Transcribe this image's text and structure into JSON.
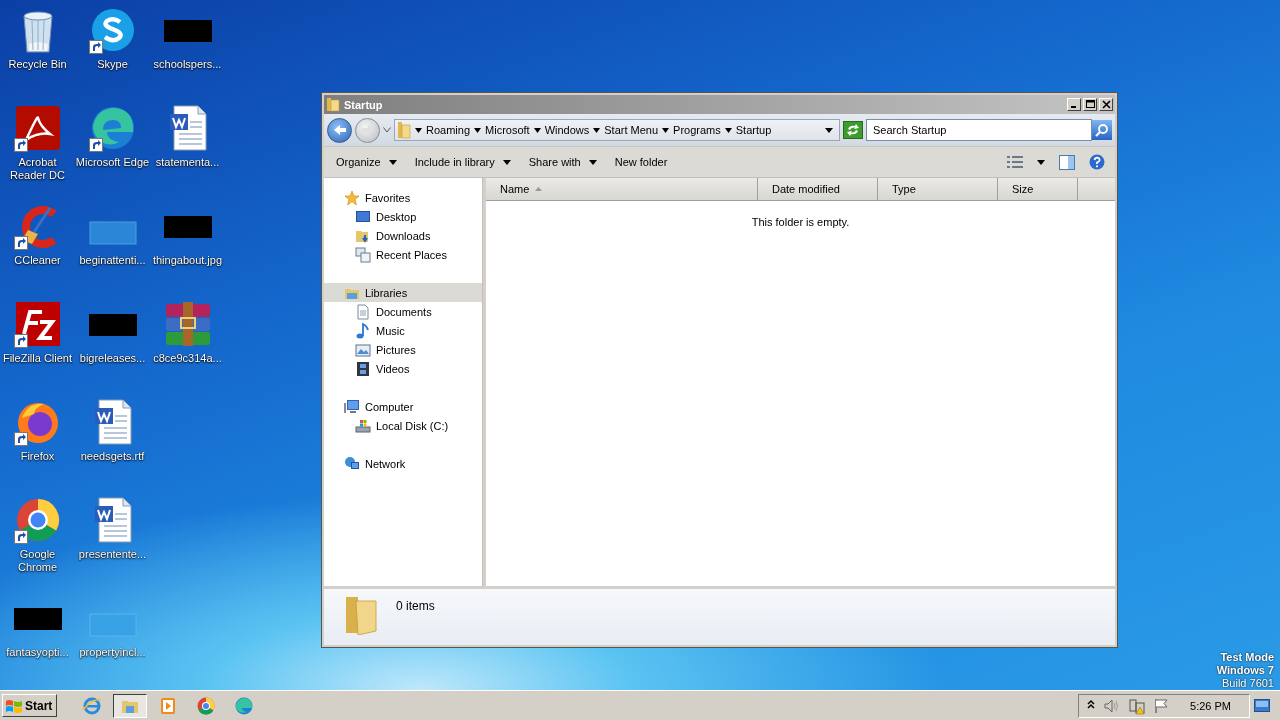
{
  "desktop": {
    "icons": [
      {
        "label": "Recycle Bin",
        "shortcut": false
      },
      {
        "label": "Acrobat Reader DC",
        "shortcut": true
      },
      {
        "label": "CCleaner",
        "shortcut": true
      },
      {
        "label": "FileZilla Client",
        "shortcut": true
      },
      {
        "label": "Firefox",
        "shortcut": true
      },
      {
        "label": "Google Chrome",
        "shortcut": true
      },
      {
        "label": "fantasyopti...",
        "shortcut": false
      },
      {
        "label": "Skype",
        "shortcut": true
      },
      {
        "label": "Microsoft Edge",
        "shortcut": true
      },
      {
        "label": "beginattenti...",
        "shortcut": false
      },
      {
        "label": "bigreleases...",
        "shortcut": false
      },
      {
        "label": "needsgets.rtf",
        "shortcut": false
      },
      {
        "label": "presentente...",
        "shortcut": false
      },
      {
        "label": "propertyincl...",
        "shortcut": false
      },
      {
        "label": "schoolspers...",
        "shortcut": false
      },
      {
        "label": "statementa...",
        "shortcut": false
      },
      {
        "label": "thingabout.jpg",
        "shortcut": false
      },
      {
        "label": "c8ce9c314a...",
        "shortcut": false
      }
    ],
    "os_notice": [
      "Test Mode",
      "Windows 7",
      "Build 7601"
    ]
  },
  "window": {
    "title": "Startup",
    "breadcrumbs": [
      "Roaming",
      "Microsoft",
      "Windows",
      "Start Menu",
      "Programs",
      "Startup"
    ],
    "search": {
      "placeholder": "Search Startup"
    },
    "toolbar": [
      {
        "label": "Organize",
        "dropdown": true
      },
      {
        "label": "Include in library",
        "dropdown": true
      },
      {
        "label": "Share with",
        "dropdown": true
      },
      {
        "label": "New folder",
        "dropdown": false
      }
    ],
    "nav": [
      {
        "label": "Favorites",
        "selected": false,
        "children": [
          {
            "label": "Desktop",
            "selected": false
          },
          {
            "label": "Downloads",
            "selected": false
          },
          {
            "label": "Recent Places",
            "selected": false
          }
        ]
      },
      {
        "label": "Libraries",
        "selected": true,
        "children": [
          {
            "label": "Documents",
            "selected": false
          },
          {
            "label": "Music",
            "selected": false
          },
          {
            "label": "Pictures",
            "selected": false
          },
          {
            "label": "Videos",
            "selected": false
          }
        ]
      },
      {
        "label": "Computer",
        "selected": false,
        "children": [
          {
            "label": "Local Disk (C:)",
            "selected": false
          }
        ]
      },
      {
        "label": "Network",
        "selected": false
      }
    ],
    "columns": [
      {
        "label": "Name",
        "sorted": true
      },
      {
        "label": "Date modified",
        "sorted": false
      },
      {
        "label": "Type",
        "sorted": false
      },
      {
        "label": "Size",
        "sorted": false
      }
    ],
    "empty_message": "This folder is empty.",
    "status": "0 items"
  },
  "taskbar": {
    "start": "Start",
    "apps": [
      {
        "active": false
      },
      {
        "active": true
      },
      {
        "active": false
      },
      {
        "active": false
      },
      {
        "active": false
      }
    ],
    "clock": "5:26 PM"
  }
}
